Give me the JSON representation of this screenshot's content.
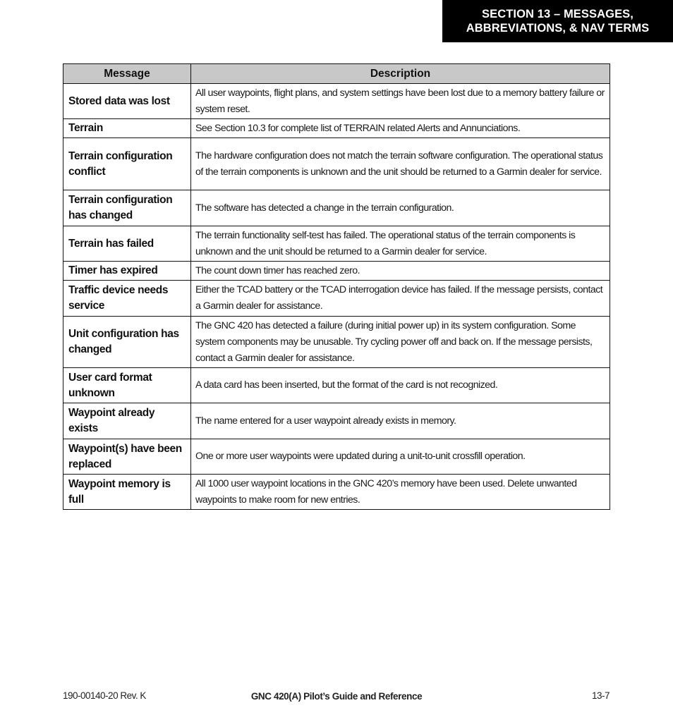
{
  "section_header": {
    "line1": "SECTION 13 – MESSAGES,",
    "line2": "ABBREVIATIONS, & NAV TERMS"
  },
  "table": {
    "columns": [
      "Message",
      "Description"
    ],
    "rows": [
      {
        "message": "Stored data was lost",
        "description": "All user waypoints, flight plans, and system settings have been lost due to a memory battery failure or system reset."
      },
      {
        "message": "Terrain",
        "description": "See Section 10.3 for complete list of TERRAIN related Alerts and Annunciations."
      },
      {
        "message": "Terrain configuration conflict",
        "description": "The hardware configuration does not match the terrain software configuration.  The operational status of the terrain components is unknown and the unit should be returned to a Garmin dealer for service."
      },
      {
        "message": "Terrain configuration has changed",
        "description": "The software has detected a change in the terrain configuration."
      },
      {
        "message": "Terrain has failed",
        "description": "The terrain functionality self-test has failed.  The operational status of the terrain components is unknown and the unit should be returned to a Garmin dealer for service."
      },
      {
        "message": "Timer has expired",
        "description": "The count down timer has reached zero."
      },
      {
        "message": "Traffic device needs service",
        "description": "Either the TCAD battery or the TCAD interrogation device has failed.  If the message persists, contact a Garmin dealer for assistance."
      },
      {
        "message": "Unit configuration has changed",
        "description": "The GNC 420 has detected a failure (during initial power up) in its system configuration.  Some system components may be unusable.  Try cycling power off and back on.  If the message persists, contact a Garmin dealer for assistance."
      },
      {
        "message": "User card format unknown",
        "description": "A data card has been inserted, but the format of the card is not recognized."
      },
      {
        "message": "Waypoint already exists",
        "description": "The name entered for a user waypoint already exists in memory."
      },
      {
        "message": "Waypoint(s) have been replaced",
        "description": "One or more user waypoints were updated during a unit-to-unit crossfill operation."
      },
      {
        "message": "Waypoint memory is full",
        "description": "All 1000 user waypoint locations in the GNC 420’s memory have been used.  Delete unwanted waypoints to make room for new entries."
      }
    ]
  },
  "footer": {
    "doc_number": "190-00140-20  Rev. K",
    "title": "GNC 420(A) Pilot’s Guide and Reference",
    "page": "13-7"
  }
}
